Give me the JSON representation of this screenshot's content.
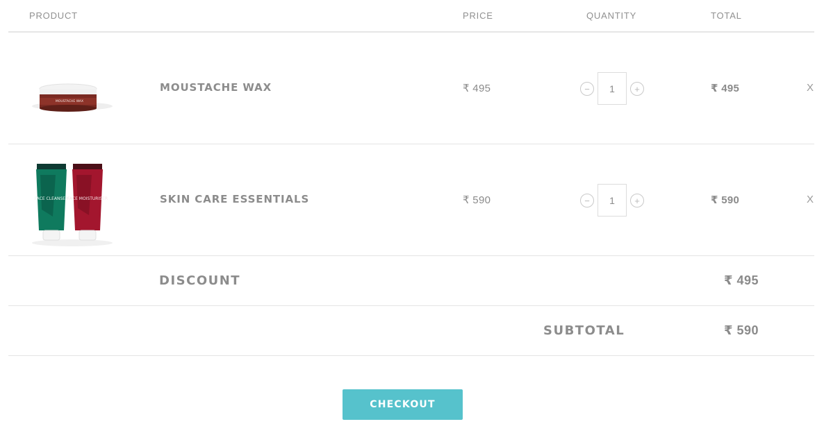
{
  "header": {
    "product": "PRODUCT",
    "price": "PRICE",
    "quantity": "QUANTITY",
    "total": "TOTAL"
  },
  "items": [
    {
      "name": "MOUSTACHE WAX",
      "price": "₹ 495",
      "quantity": "1",
      "total": "₹ 495",
      "remove": "X",
      "minus": "−",
      "plus": "+",
      "image_label": "MOUSTACHE WAX"
    },
    {
      "name": "SKIN CARE ESSENTIALS",
      "price": "₹ 590",
      "quantity": "1",
      "total": "₹ 590",
      "remove": "X",
      "minus": "−",
      "plus": "+",
      "image_labels": [
        "FACE CLEANSER",
        "FACE MOISTURISER"
      ]
    }
  ],
  "discount": {
    "label": "DISCOUNT",
    "value": "₹ 495"
  },
  "subtotal": {
    "label": "SUBTOTAL",
    "value": "₹ 590"
  },
  "checkout_label": "CHECKOUT",
  "colors": {
    "accent": "#56c2cc",
    "text": "#8a8a8a",
    "divider": "#e4e4e4"
  }
}
